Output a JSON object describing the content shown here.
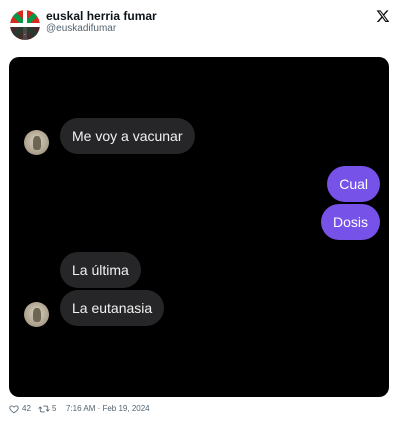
{
  "tweet": {
    "author_name": "euskal herria fumar",
    "author_handle": "@euskadifumar",
    "likes": "42",
    "retweets": "5",
    "timestamp": "7:16 AM · Feb 19, 2024"
  },
  "icons": {
    "platform": "x-logo-icon",
    "like": "heart-icon",
    "retweet": "retweet-icon"
  },
  "chat": {
    "messages": [
      {
        "side": "received",
        "text": "Me voy a vacunar"
      },
      {
        "side": "sent",
        "text": "Cual"
      },
      {
        "side": "sent",
        "text": "Dosis"
      },
      {
        "side": "received",
        "text": "La última"
      },
      {
        "side": "received",
        "text": "La eutanasia"
      }
    ]
  },
  "colors": {
    "sent_bubble": "#7652e8",
    "received_bubble": "#262628",
    "chat_background": "#000000"
  }
}
